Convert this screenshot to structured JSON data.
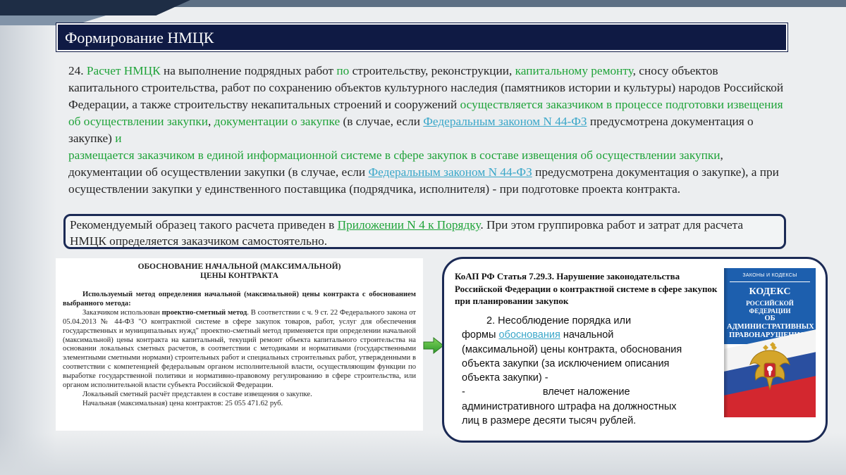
{
  "slide": {
    "title": "Формирование НМЦК"
  },
  "main_paragraph": {
    "n": "24. ",
    "s1": "Расчет НМЦК",
    "s2": " на выполнение подрядных работ ",
    "s3": "по",
    "s4": " строительству, реконструкции, ",
    "s5": "капитальному ремонту",
    "s6": ", сносу объектов капитального строительства, работ по сохранению объектов культурного наследия (памятников истории и культуры) народов Российской Федерации, а также строительству некапитальных строений и сооружений ",
    "s7": "осуществляется заказчиком в процессе подготовки извещения об осуществлении закупки",
    "s8": ", ",
    "s9": "документации о закупке",
    "s10": " (в случае, если ",
    "s11": "Федеральным законом N 44-ФЗ",
    "s12": " предусмотрена документация о закупке) ",
    "s13": "и",
    "s14": " размещается заказчиком в единой информационной системе в сфере закупок в составе извещения об осуществлении закупки",
    "s15": ", документации об осуществлении закупки (в случае, если ",
    "s16": "Федеральным законом N 44-ФЗ",
    "s17": " предусмотрена документация о закупке), а при осуществлении закупки у единственного поставщика (подрядчика, исполнителя) - при подготовке проекта контракта."
  },
  "recommendation": {
    "a": "Рекомендуемый образец такого расчета приведен в ",
    "link": "Приложении N 4 к Порядку",
    "b": ". При этом группировка работ и затрат для расчета НМЦК определяется заказчиком самостоятельно."
  },
  "document_sample": {
    "title_line1": "ОБОСНОВАНИЕ НАЧАЛЬНОЙ (МАКСИМАЛЬНОЙ)",
    "title_line2": "ЦЕНЫ КОНТРАКТА",
    "method_heading": "Используемый метод определения начальной (максимальной) цены контракта с обоснованием выбранного метода:",
    "p1_a": "Заказчиком использован ",
    "p1_bold": "проектно-сметный метод",
    "p1_b": ". В соответствии с ч. 9 ст. 22 Федерального закона от 05.04.2013 № 44-ФЗ \"О контрактной системе в сфере закупок товаров, работ, услуг для обеспечения государственных и муниципальных нужд\" проектно-сметный метод применяется при определении начальной (максимальной) цены контракта на капитальный, текущий ремонт объекта капитального строительства на основании локальных сметных расчетов, в соответствии с методиками и нормативами (государственными элементными сметными нормами) строительных работ и специальных строительных работ, утвержденными в соответствии с компетенцией федеральным органом исполнительной власти, осуществляющим функции по выработке государственной политики и нормативно-правовому регулированию в сфере строительства, или органом исполнительной власти субъекта Российской Федерации.",
    "p2": "Локальный сметный расчёт представлен в составе извещения о закупке.",
    "p3": "Начальная (максимальная) цена контрактов: 25 055 471.62 руб."
  },
  "koap": {
    "heading": "КоАП РФ Статья 7.29.3. Нарушение законодательства Российской Федерации о контрактной системе в сфере закупок при планировании закупок",
    "line1": "2. Несоблюдение порядка или",
    "line2_a": "формы ",
    "line2_link": "обоснования",
    "line2_b": " начальной",
    "line3": "(максимальной) цены контракта, обоснования",
    "line4": "объекта закупки (за исключением описания",
    "line5": "объекта закупки) -",
    "line6_dash": "-",
    "line6_text": "влечет наложение",
    "line7": "административного штрафа на должностных",
    "line8": "лиц в размере десяти тысяч рублей."
  },
  "book_cover": {
    "series": "ЗАКОНЫ И КОДЕКСЫ",
    "title": "КОДЕКС",
    "subtitle_line1": "РОССИЙСКОЙ ФЕДЕРАЦИИ",
    "subtitle_line2": "ОБ АДМИНИСТРАТИВНЫХ",
    "subtitle_line3": "ПРАВОНАРУШЕНИЯХ"
  },
  "colors": {
    "title_bg": "#0f1a44",
    "highlight_green": "#1fa339",
    "link_blue": "#3aa7c9",
    "frame_navy": "#1b2a55"
  },
  "icons": {
    "arrow": "green-right-arrow-icon",
    "eagle": "coat-of-arms-icon"
  }
}
